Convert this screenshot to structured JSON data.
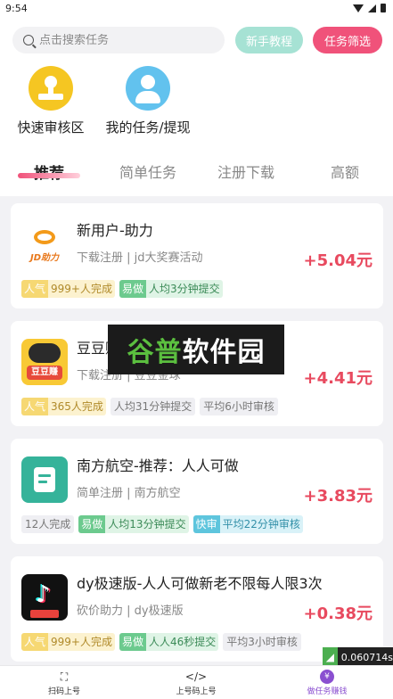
{
  "status_bar": {
    "time": "9:54"
  },
  "header": {
    "search_placeholder": "点击搜索任务",
    "tutorial_button": "新手教程",
    "filter_button": "任务筛选",
    "quick_entries": [
      {
        "label": "快速审核区",
        "icon": "stamp-icon"
      },
      {
        "label": "我的任务/提现",
        "icon": "user-icon"
      }
    ]
  },
  "tabs": [
    {
      "label": "推荐",
      "active": true
    },
    {
      "label": "简单任务",
      "active": false
    },
    {
      "label": "注册下载",
      "active": false
    },
    {
      "label": "高额",
      "active": false
    }
  ],
  "tasks": [
    {
      "title": "新用户-助力",
      "sub": "下载注册 | jd大奖赛活动",
      "price": "+5.04元",
      "logo_text": "JD助力",
      "tags": [
        {
          "kind": "pop",
          "k": "人气",
          "v": "999+人完成"
        },
        {
          "kind": "easy",
          "k": "易做",
          "v": "人均3分钟提交"
        }
      ]
    },
    {
      "title": "豆豆",
      "title_hidden_tail": "赚",
      "sub": "下载注册 | 豆豆金球",
      "price": "+4.41元",
      "logo_text": "豆豆赚",
      "tags": [
        {
          "kind": "pop",
          "k": "人气",
          "v": "365人完成"
        },
        {
          "kind": "plain",
          "v": "人均31分钟提交"
        },
        {
          "kind": "plain",
          "v": "平均6小时审核"
        }
      ]
    },
    {
      "title": "南方航空-推荐：人人可做",
      "sub": "简单注册 | 南方航空",
      "price": "+3.83元",
      "tags": [
        {
          "kind": "plain",
          "v": "12人完成"
        },
        {
          "kind": "easy",
          "k": "易做",
          "v": "人均13分钟提交"
        },
        {
          "kind": "fast",
          "k": "快审",
          "v": "平均22分钟审核"
        }
      ]
    },
    {
      "title": "dy极速版-人人可做新老不限每人限3次",
      "sub": "砍价助力 | dy极速版",
      "price": "+0.38元",
      "logo_text": "领现金",
      "tags": [
        {
          "kind": "pop",
          "k": "人气",
          "v": "999+人完成"
        },
        {
          "kind": "easy",
          "k": "易做",
          "v": "人人46秒提交"
        },
        {
          "kind": "plain",
          "v": "平均3小时审核"
        }
      ]
    }
  ],
  "watermark": {
    "part1": "谷普",
    "part2": "软件园"
  },
  "timer": {
    "value": "0.060714s"
  },
  "bottom_nav": [
    {
      "label": "扫码上号",
      "icon": "scan-icon"
    },
    {
      "label": "上号码上号",
      "icon": "code-icon"
    },
    {
      "label": "做任务赚钱",
      "icon": "money-bag-icon",
      "active": true
    }
  ],
  "colors": {
    "accent": "#f0527a",
    "price": "#e84a5f",
    "tutorial": "#a6e2d4",
    "active_nav": "#8a4fd0"
  }
}
